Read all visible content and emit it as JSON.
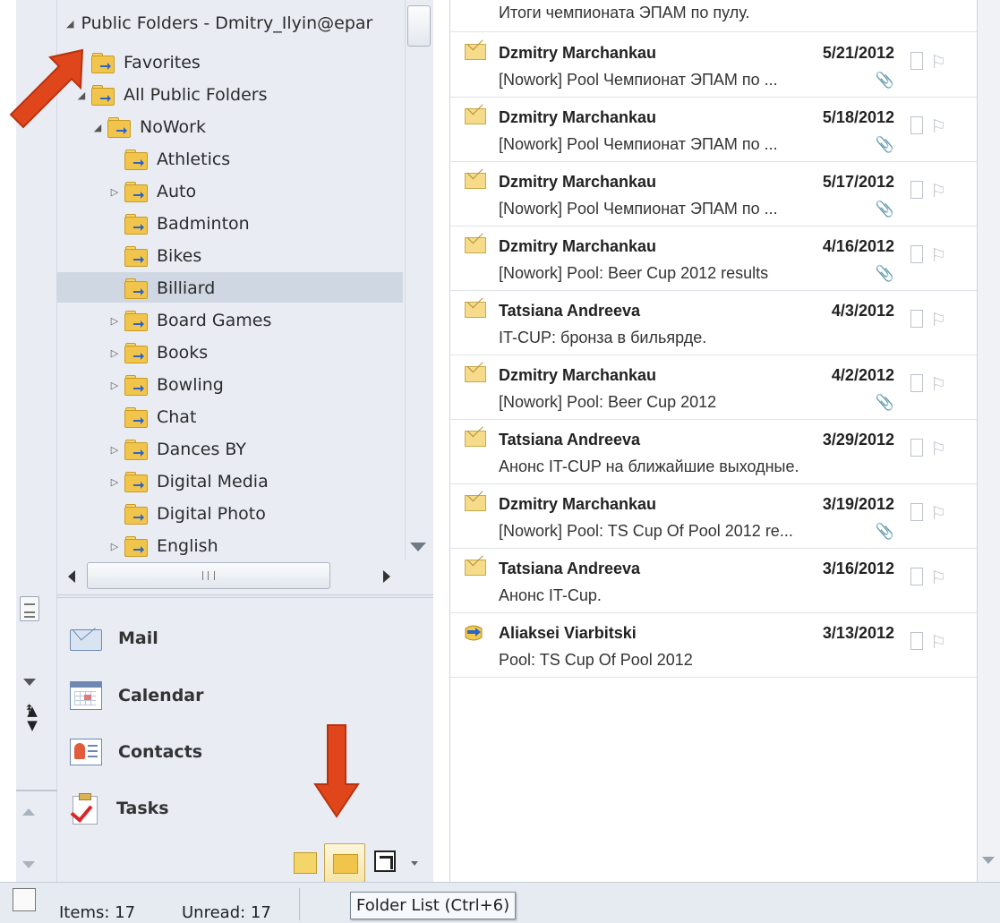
{
  "folder_tree": {
    "root": "Public Folders - Dmitry_Ilyin@epar",
    "items": [
      {
        "label": "Favorites",
        "indent": 1,
        "expander": ""
      },
      {
        "label": "All Public Folders",
        "indent": 1,
        "expander": "◢"
      },
      {
        "label": "NoWork",
        "indent": 2,
        "expander": "◢"
      },
      {
        "label": "Athletics",
        "indent": 3,
        "expander": ""
      },
      {
        "label": "Auto",
        "indent": 3,
        "expander": "▷"
      },
      {
        "label": "Badminton",
        "indent": 3,
        "expander": ""
      },
      {
        "label": "Bikes",
        "indent": 3,
        "expander": ""
      },
      {
        "label": "Billiard",
        "indent": 3,
        "expander": "",
        "selected": true
      },
      {
        "label": "Board Games",
        "indent": 3,
        "expander": "▷"
      },
      {
        "label": "Books",
        "indent": 3,
        "expander": "▷"
      },
      {
        "label": "Bowling",
        "indent": 3,
        "expander": "▷"
      },
      {
        "label": "Chat",
        "indent": 3,
        "expander": ""
      },
      {
        "label": "Dances BY",
        "indent": 3,
        "expander": "▷"
      },
      {
        "label": "Digital Media",
        "indent": 3,
        "expander": "▷"
      },
      {
        "label": "Digital Photo",
        "indent": 3,
        "expander": ""
      },
      {
        "label": "English",
        "indent": 3,
        "expander": "▷"
      }
    ]
  },
  "nav": {
    "mail": "Mail",
    "calendar": "Calendar",
    "contacts": "Contacts",
    "tasks": "Tasks"
  },
  "status": {
    "items": "Items: 17",
    "unread": "Unread: 17",
    "tooltip": "Folder List (Ctrl+6)"
  },
  "messages": {
    "top_partial": "Итоги чемпионата ЭПАМ по пулу.",
    "rows": [
      {
        "sender": "Dzmitry Marchankau",
        "date": "5/21/2012",
        "subject": "[Nowork] Pool Чемпионат ЭПАМ по ...",
        "attachment": true
      },
      {
        "sender": "Dzmitry Marchankau",
        "date": "5/18/2012",
        "subject": "[Nowork] Pool Чемпионат ЭПАМ по ...",
        "attachment": true
      },
      {
        "sender": "Dzmitry Marchankau",
        "date": "5/17/2012",
        "subject": "[Nowork] Pool Чемпионат ЭПАМ по ...",
        "attachment": true
      },
      {
        "sender": "Dzmitry Marchankau",
        "date": "4/16/2012",
        "subject": "[Nowork] Pool: Beer Cup 2012 results",
        "attachment": true
      },
      {
        "sender": "Tatsiana Andreeva",
        "date": "4/3/2012",
        "subject": "IT-CUP: бронза в бильярде.",
        "attachment": false
      },
      {
        "sender": "Dzmitry Marchankau",
        "date": "4/2/2012",
        "subject": "[Nowork] Pool: Beer Cup 2012",
        "attachment": true
      },
      {
        "sender": "Tatsiana Andreeva",
        "date": "3/29/2012",
        "subject": " Анонс IT-CUP на ближайшие выходные.",
        "attachment": false
      },
      {
        "sender": "Dzmitry Marchankau",
        "date": "3/19/2012",
        "subject": "[Nowork] Pool: TS Cup Of Pool 2012 re...",
        "attachment": true
      },
      {
        "sender": "Tatsiana Andreeva",
        "date": "3/16/2012",
        "subject": "Анонс IT-Cup.",
        "attachment": false
      },
      {
        "sender": "Aliaksei Viarbitski",
        "date": "3/13/2012",
        "subject": "Pool: TS Cup Of Pool 2012",
        "attachment": false,
        "icon": "post-icon"
      }
    ]
  },
  "colors": {
    "annotation_arrow": "#e0461b",
    "selection": "#cfd7e2"
  }
}
